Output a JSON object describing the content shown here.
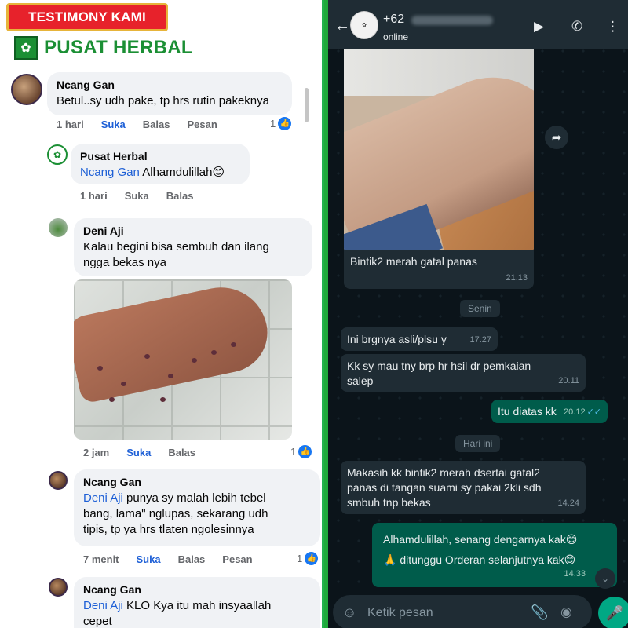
{
  "left": {
    "banner": "TESTIMONY KAMI",
    "brand": "PUSAT HERBAL",
    "comments": [
      {
        "name": "Ncang Gan",
        "text": "Betul..sy udh pake, tp hrs rutin pakeknya",
        "time": "1 hari",
        "like": "Suka",
        "reply": "Balas",
        "message": "Pesan",
        "count": "1"
      },
      {
        "name": "Pusat Herbal",
        "mention": "Ncang Gan",
        "text": " Alhamdulillah😊",
        "time": "1 hari",
        "like": "Suka",
        "reply": "Balas"
      },
      {
        "name": "Deni Aji",
        "text_line1": "Kalau begini bisa sembuh dan ilang",
        "text_line2": "ngga bekas nya",
        "time": "2 jam",
        "like": "Suka",
        "reply": "Balas",
        "count": "1"
      },
      {
        "name": "Ncang Gan",
        "mention": "Deni Aji",
        "text_line1": " punya sy malah lebih tebel",
        "text_line2": "bang, lama\" nglupas, sekarang udh",
        "text_line3": "tipis, tp ya hrs tlaten ngolesinnya",
        "time": "7 menit",
        "like": "Suka",
        "reply": "Balas",
        "message": "Pesan",
        "count": "1"
      },
      {
        "name": "Ncang Gan",
        "mention": "Deni Aji",
        "text_line1": " KLO Kya itu mah insyaallah",
        "text_line2": "cepet"
      }
    ]
  },
  "whatsapp": {
    "phone": "+62",
    "status": "online",
    "messages": [
      {
        "text": "Bintik2 merah gatal panas",
        "time": "21.13"
      },
      {
        "day": "Senin"
      },
      {
        "text": "Ini brgnya asli/plsu y",
        "time": "17.27"
      },
      {
        "text_line1": "Kk sy mau tny brp hr hsil dr pemkaian",
        "text_line2": "salep",
        "time": "20.11"
      },
      {
        "text": "Itu diatas kk",
        "time": "20.12",
        "ticks": "✓✓"
      },
      {
        "day": "Hari ini"
      },
      {
        "text_line1": "Makasih kk bintik2 merah dsertai gatal2",
        "text_line2": "panas di tangan suami sy pakai 2kli sdh",
        "text_line3": "smbuh tnp bekas",
        "time": "14.24"
      },
      {
        "text_line1": "Alhamdulillah, senang dengarnya kak😊",
        "text_line2": "🙏 ditunggu Orderan selanjutnya kak😊",
        "time": "14.33"
      }
    ],
    "input_placeholder": "Ketik pesan"
  },
  "colors": {
    "fb_link": "#1d5fd6",
    "wa_bg": "#0b141a",
    "wa_out": "#005c4b",
    "wa_in": "#1f2c34",
    "brand_green": "#1b8f34",
    "banner_red": "#e7222b"
  }
}
